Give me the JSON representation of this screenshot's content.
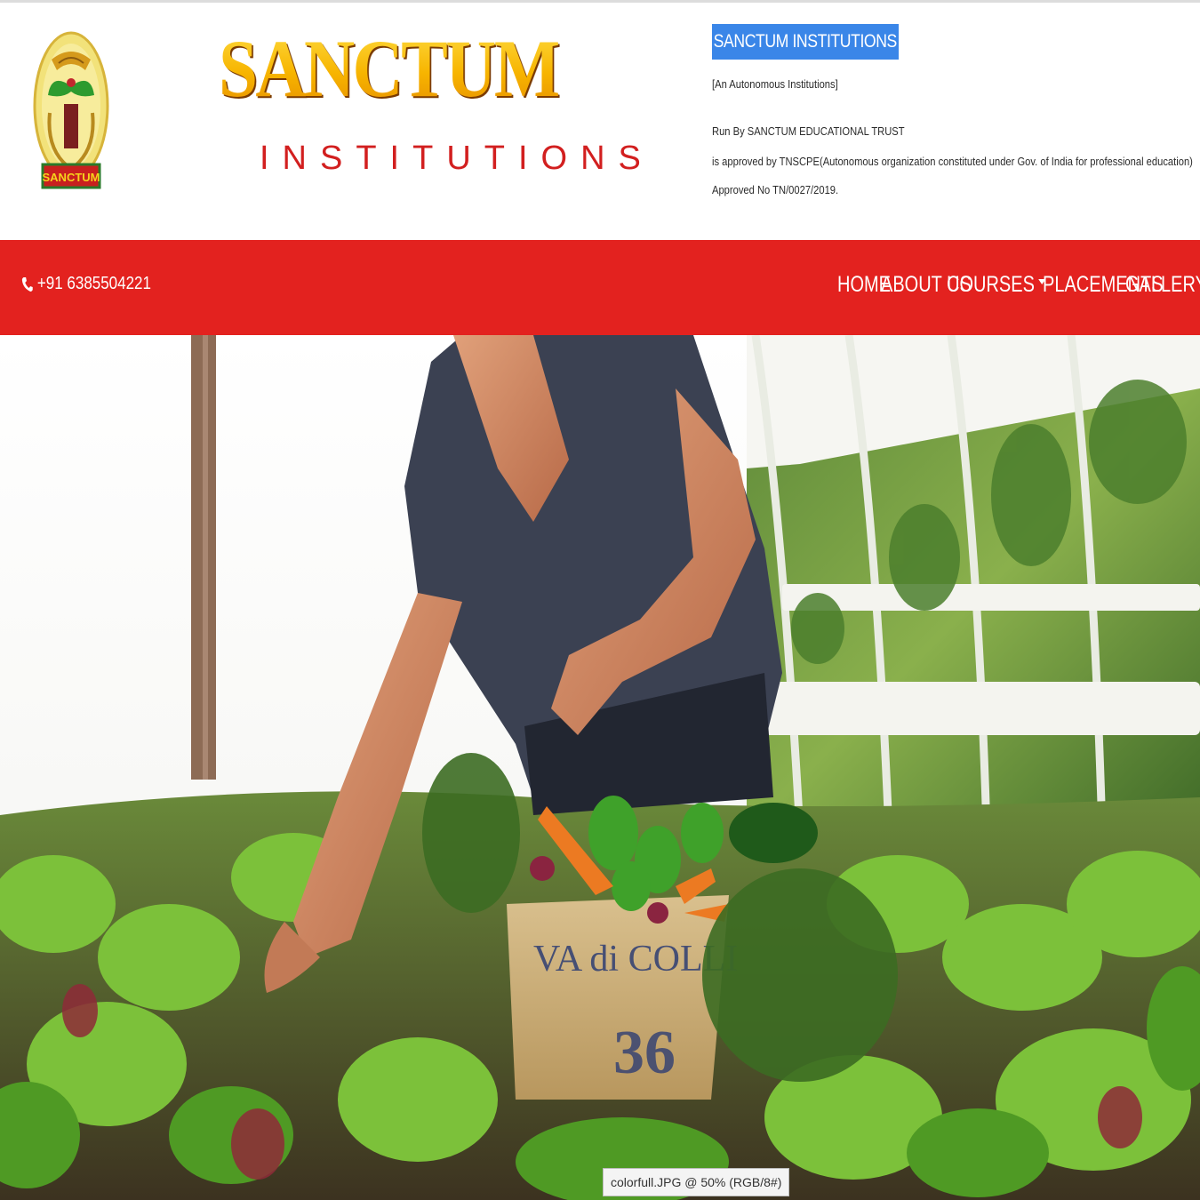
{
  "header": {
    "logo_emblem_text": "SANCTUM",
    "brand_title": "SANCTUM",
    "brand_subtitle": "INSTITUTIONS",
    "info_title": "SANCTUM INSTITUTIONS",
    "info_tagline": "[An Autonomous Institutions]",
    "info_run_by": "Run By SANCTUM EDUCATIONAL TRUST",
    "info_approval": "is approved by TNSCPE(Autonomous organization constituted under Gov. of India for professional education)",
    "info_approved_no": "Approved No TN/0027/2019."
  },
  "navbar": {
    "phone": "+91 6385504221",
    "items": [
      {
        "label": "HOME"
      },
      {
        "label": "ABOUT US"
      },
      {
        "label": "COURSES",
        "has_dropdown": true
      },
      {
        "label": "PLACEMENTS"
      },
      {
        "label": "GALLERY"
      }
    ]
  },
  "hero": {
    "crate_text_line1": "VA di COLLI",
    "crate_text_line2": "36"
  },
  "status_tooltip": "colorfull.JPG @ 50% (RGB/8#)",
  "colors": {
    "nav_background": "#e3221f",
    "info_title_highlight": "#3a86e8",
    "brand_gold": "#f5b800",
    "brand_red": "#d21f1f"
  }
}
